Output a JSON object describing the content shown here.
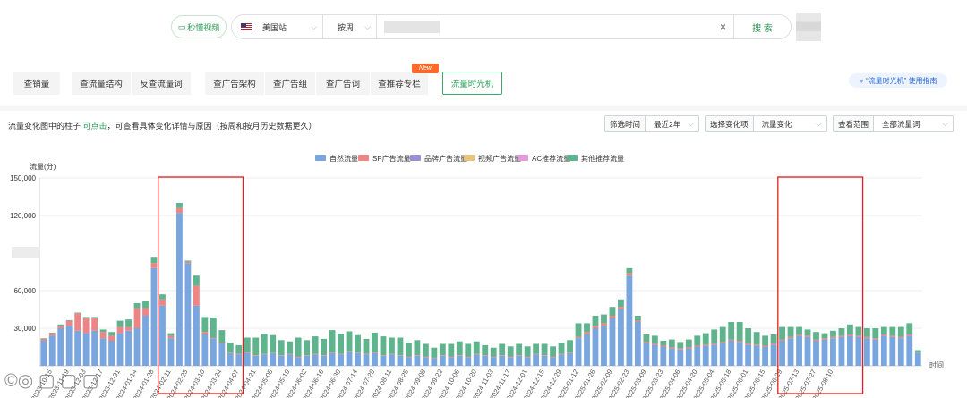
{
  "top": {
    "quick_video": "秒懂视频",
    "site": "美国站",
    "unit": "按周",
    "search_btn": "搜 索"
  },
  "tabs": [
    {
      "label": "查销量"
    },
    {
      "label": "查流量结构"
    },
    {
      "label": "反查流量词"
    },
    {
      "label": "查广告架构"
    },
    {
      "label": "查广告组"
    },
    {
      "label": "查广告词"
    },
    {
      "label": "查推荐专栏"
    },
    {
      "label": "流量时光机"
    }
  ],
  "new_badge": "New",
  "guide": "“流量时光机” 使用指南",
  "hint": {
    "pre": "流量变化图中的柱子 ",
    "link": "可点击",
    "post": "，可查看具体变化详情与原因（按周和按月历史数据更久）"
  },
  "filters": [
    {
      "label": "筛选时间",
      "value": "最近2年"
    },
    {
      "label": "选择变化项",
      "value": "流量变化"
    },
    {
      "label": "查看范围",
      "value": "全部流量词"
    }
  ],
  "colors": {
    "natural": "#7aa6e0",
    "sp": "#ec8585",
    "brand": "#9a8fd6",
    "video": "#e8c47b",
    "ac": "#e39ad8",
    "other": "#5fb38d",
    "highlight": "#e02020",
    "accent": "#2e9a55"
  },
  "chart_data": {
    "type": "bar",
    "stacked": true,
    "ylabel": "流量(分)",
    "xlabel": "时间",
    "ylim": [
      0,
      150000
    ],
    "yticks": [
      "150,000",
      "120,000",
      "60,000",
      "30,000"
    ],
    "ytick_values": [
      150000,
      120000,
      60000,
      30000
    ],
    "legend_position": "top-center",
    "grid": true,
    "xtick_labels": [
      "2023-10-15",
      "2023-11-19",
      "2023-12-03",
      "2023-12-17",
      "2023-12-31",
      "2024-01-14",
      "2024-01-28",
      "2024-02-11",
      "2024-02-25",
      "2024-03-10",
      "2024-03-24",
      "2024-04-07",
      "2024-04-21",
      "2024-05-05",
      "2024-05-19",
      "2024-06-02",
      "2024-06-16",
      "2024-06-30",
      "2024-07-14",
      "2024-07-28",
      "2024-08-11",
      "2024-08-25",
      "2024-09-08",
      "2024-09-22",
      "2024-10-06",
      "2024-10-20",
      "2024-11-03",
      "2024-11-17",
      "2024-12-01",
      "2024-12-15",
      "2024-12-29",
      "2025-01-12",
      "2025-01-26",
      "2025-02-09",
      "2025-02-23",
      "2025-03-09",
      "2025-03-23",
      "2025-04-06",
      "2025-04-20",
      "2025-05-04",
      "2025-05-18",
      "2025-06-01",
      "2025-06-15",
      "2025-06-29",
      "2025-07-13",
      "2025-07-27",
      "2025-08-10"
    ],
    "xtick_every": 2,
    "highlights": [
      {
        "from": 14,
        "to": 23
      },
      {
        "from": 87,
        "to": 96
      }
    ],
    "series": [
      {
        "name": "自然流量",
        "color": "#7aa6e0",
        "values": [
          20000,
          24000,
          30000,
          32000,
          28000,
          26000,
          28000,
          22000,
          20000,
          26000,
          28000,
          30000,
          40000,
          78000,
          48000,
          22000,
          122000,
          82000,
          48000,
          25000,
          22000,
          18000,
          10000,
          9000,
          10000,
          8000,
          9000,
          10000,
          8000,
          9000,
          7000,
          8000,
          9000,
          8000,
          10000,
          9000,
          11000,
          10000,
          9000,
          10000,
          8000,
          9000,
          8000,
          7000,
          8000,
          7000,
          6000,
          8000,
          7000,
          8000,
          7000,
          9000,
          8000,
          7000,
          8000,
          7000,
          8000,
          7000,
          9000,
          8000,
          7000,
          9000,
          10000,
          22000,
          25000,
          30000,
          32000,
          38000,
          45000,
          72000,
          35000,
          18000,
          17000,
          15000,
          14000,
          13000,
          14000,
          15000,
          16000,
          17000,
          18000,
          20000,
          19000,
          17000,
          16000,
          15000,
          17000,
          20000,
          22000,
          24000,
          23000,
          20000,
          21000,
          22000,
          23000,
          24000,
          23000,
          22000,
          21000,
          24000,
          23000,
          22000,
          24000,
          10000
        ]
      },
      {
        "name": "SP广告流量",
        "color": "#ec8585",
        "values": [
          1500,
          2000,
          2000,
          4000,
          14000,
          12000,
          10000,
          5000,
          4000,
          5000,
          3000,
          16000,
          6000,
          4000,
          5000,
          2000,
          4000,
          1000,
          16000,
          2000,
          500,
          500,
          500,
          500,
          500,
          500,
          500,
          500,
          500,
          500,
          500,
          500,
          500,
          500,
          500,
          500,
          500,
          500,
          500,
          500,
          500,
          500,
          500,
          500,
          500,
          500,
          500,
          500,
          500,
          500,
          500,
          500,
          500,
          500,
          500,
          500,
          500,
          500,
          500,
          500,
          500,
          500,
          500,
          1000,
          2000,
          2000,
          2000,
          2000,
          2000,
          2000,
          1000,
          1000,
          1000,
          1000,
          1000,
          1000,
          1000,
          1000,
          1000,
          1000,
          1000,
          1000,
          1000,
          1000,
          1000,
          1000,
          1000,
          1000,
          1000,
          1000,
          1000,
          1000,
          1000,
          1000,
          1000,
          1000,
          1000,
          1000,
          1000,
          1000,
          1000,
          1000,
          1000,
          500
        ]
      },
      {
        "name": "品牌广告流量",
        "color": "#9a8fd6",
        "values": [
          0,
          0,
          0,
          0,
          0,
          0,
          0,
          0,
          0,
          0,
          0,
          0,
          0,
          0,
          0,
          0,
          0,
          0,
          0,
          0,
          0,
          0,
          0,
          0,
          0,
          0,
          0,
          0,
          0,
          0,
          0,
          0,
          0,
          0,
          0,
          0,
          0,
          0,
          0,
          0,
          0,
          0,
          0,
          0,
          0,
          0,
          0,
          0,
          0,
          0,
          0,
          0,
          0,
          0,
          0,
          0,
          0,
          0,
          0,
          0,
          0,
          0,
          0,
          0,
          0,
          0,
          0,
          0,
          0,
          0,
          0,
          0,
          0,
          0,
          0,
          0,
          0,
          0,
          0,
          0,
          0,
          0,
          0,
          0,
          0,
          0,
          0,
          0,
          0,
          0,
          0,
          0,
          0,
          0,
          0,
          0,
          0,
          0,
          0,
          0,
          0,
          0,
          0,
          0
        ]
      },
      {
        "name": "视频广告流量",
        "color": "#e8c47b",
        "values": [
          0,
          0,
          0,
          0,
          0,
          0,
          0,
          0,
          0,
          0,
          0,
          0,
          0,
          0,
          0,
          0,
          0,
          0,
          0,
          0,
          0,
          0,
          0,
          0,
          0,
          0,
          0,
          0,
          0,
          0,
          0,
          0,
          0,
          0,
          0,
          0,
          0,
          0,
          0,
          0,
          0,
          0,
          0,
          0,
          0,
          0,
          0,
          0,
          0,
          0,
          0,
          0,
          0,
          0,
          0,
          0,
          0,
          0,
          0,
          0,
          0,
          0,
          0,
          0,
          0,
          0,
          0,
          0,
          0,
          0,
          0,
          0,
          0,
          0,
          0,
          0,
          0,
          0,
          0,
          0,
          0,
          0,
          0,
          0,
          0,
          0,
          0,
          0,
          0,
          0,
          0,
          0,
          0,
          0,
          0,
          0,
          0,
          0,
          0,
          0,
          0,
          0,
          0,
          0
        ]
      },
      {
        "name": "AC推荐流量",
        "color": "#e39ad8",
        "values": [
          0,
          0,
          0,
          0,
          0,
          0,
          0,
          0,
          0,
          0,
          0,
          0,
          0,
          0,
          0,
          0,
          0,
          0,
          0,
          0,
          0,
          0,
          0,
          0,
          0,
          0,
          0,
          0,
          0,
          0,
          0,
          0,
          0,
          0,
          0,
          0,
          0,
          0,
          0,
          0,
          0,
          0,
          0,
          0,
          0,
          0,
          0,
          0,
          0,
          0,
          0,
          0,
          0,
          0,
          0,
          0,
          0,
          0,
          0,
          0,
          0,
          0,
          0,
          0,
          0,
          0,
          0,
          0,
          0,
          0,
          0,
          0,
          0,
          0,
          0,
          0,
          0,
          0,
          0,
          0,
          0,
          0,
          0,
          0,
          0,
          0,
          0,
          0,
          0,
          0,
          0,
          0,
          0,
          0,
          0,
          0,
          0,
          0,
          0,
          0,
          0,
          0,
          0,
          0
        ]
      },
      {
        "name": "其他推荐流量",
        "color": "#5fb38d",
        "values": [
          500,
          500,
          1000,
          500,
          500,
          1000,
          1000,
          2000,
          3000,
          5000,
          6000,
          4000,
          6000,
          5000,
          4000,
          2000,
          4000,
          1000,
          8000,
          12000,
          16000,
          10000,
          8000,
          7000,
          12000,
          14000,
          16000,
          14000,
          12000,
          10000,
          15000,
          12000,
          14000,
          13000,
          18000,
          16000,
          16000,
          14000,
          12000,
          16000,
          15000,
          13000,
          14000,
          11000,
          12000,
          10000,
          8000,
          9000,
          10000,
          11000,
          10000,
          10000,
          8000,
          7000,
          9000,
          8000,
          9000,
          8000,
          8000,
          9000,
          8000,
          9000,
          10000,
          11000,
          7000,
          8000,
          7000,
          7000,
          6000,
          4000,
          4000,
          6000,
          6000,
          4000,
          6000,
          5000,
          6000,
          8000,
          9000,
          11000,
          12000,
          14000,
          15000,
          12000,
          10000,
          8000,
          7000,
          10000,
          8000,
          6000,
          5000,
          6000,
          4000,
          5000,
          6000,
          8000,
          7000,
          7000,
          8000,
          6000,
          7000,
          8000,
          9000,
          2000
        ]
      }
    ]
  }
}
